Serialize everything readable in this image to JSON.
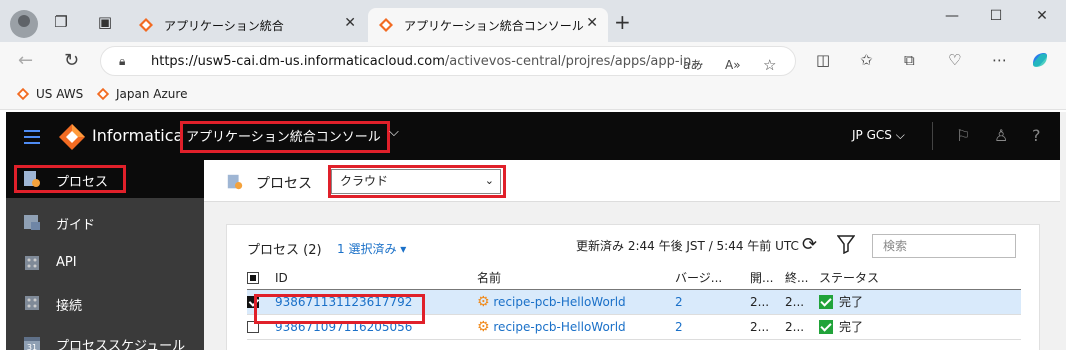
{
  "browser": {
    "tabs": [
      {
        "title": "アプリケーション統合"
      },
      {
        "title": "アプリケーション統合コンソール"
      }
    ],
    "url": {
      "host": "https://usw5-cai.dm-us.informaticacloud.com",
      "path": "/activevos-central/projres/apps/app-in..."
    },
    "bookmarks": [
      {
        "label": "US AWS"
      },
      {
        "label": "Japan Azure"
      }
    ],
    "icons": {
      "new_tab": "+",
      "reader": "aあ",
      "read_aloud": "A»"
    }
  },
  "app": {
    "brand": "Informatica",
    "console_title": "アプリケーション統合コンソール",
    "org": "JP GCS",
    "sidebar": [
      {
        "label": "プロセス",
        "active": true
      },
      {
        "label": "ガイド"
      },
      {
        "label": "API"
      },
      {
        "label": "接続"
      },
      {
        "label": "プロセススケジュール"
      }
    ],
    "subheader": {
      "label": "プロセス",
      "select_value": "クラウド"
    },
    "panel": {
      "title": "プロセス (2)",
      "selection": "1 選択済み",
      "updated": "更新済み 2:44 午後 JST / 5:44 午前 UTC",
      "search_placeholder": "検索"
    },
    "table": {
      "columns": [
        "ID",
        "名前",
        "バージ...",
        "開...",
        "終...",
        "ステータス"
      ],
      "rows": [
        {
          "id": "938671131123617792",
          "name": "recipe-pcb-HelloWorld",
          "version": "2",
          "start": "2...",
          "end": "2...",
          "status": "完了",
          "checked": true
        },
        {
          "id": "938671097116205056",
          "name": "recipe-pcb-HelloWorld",
          "version": "2",
          "start": "2...",
          "end": "2...",
          "status": "完了",
          "checked": false
        }
      ]
    }
  },
  "colors": {
    "highlight": "#e0202a",
    "accent": "#1a70c8",
    "status_ok": "#21a33a"
  }
}
